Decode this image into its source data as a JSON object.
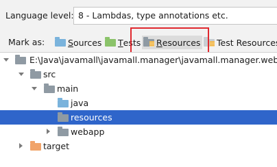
{
  "language_level": {
    "label": "Language level:",
    "value": "8 - Lambdas, type annotations etc."
  },
  "mark_as": {
    "label": "Mark as:",
    "buttons": [
      {
        "label_first": "S",
        "label_rest": "ources",
        "icon": "sources-folder-icon"
      },
      {
        "label_first": "T",
        "label_rest": "ests",
        "icon": "tests-folder-icon"
      },
      {
        "label_first": "R",
        "label_rest": "esources",
        "icon": "resources-folder-icon"
      },
      {
        "label_first": "",
        "label_rest": "Test Resources",
        "icon": "test-resources-folder-icon"
      }
    ]
  },
  "tree": [
    {
      "label": "E:\\Java\\javamall\\javamall.manager\\javamall.manager.web",
      "expanded": true
    },
    {
      "label": "src",
      "expanded": true
    },
    {
      "label": "main",
      "expanded": true
    },
    {
      "label": "java"
    },
    {
      "label": "resources",
      "selected": true
    },
    {
      "label": "webapp",
      "expanded": false
    },
    {
      "label": "target",
      "expanded": false
    }
  ],
  "colors": {
    "selection": "#2f65ca",
    "highlight_box": "#e0282e",
    "sources_folder": "#7ab3dc",
    "tests_folder": "#8bc36a",
    "excluded_folder": "#f1a46a"
  }
}
